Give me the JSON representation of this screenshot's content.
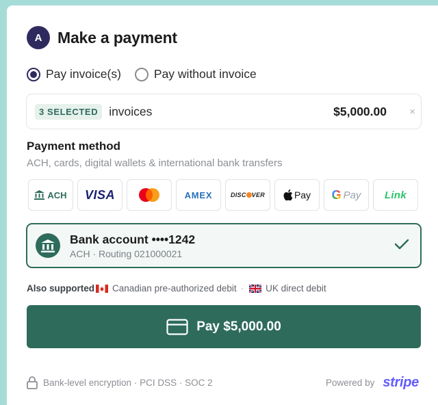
{
  "header": {
    "avatar_letter": "A",
    "title": "Make a payment"
  },
  "mode": {
    "options": [
      {
        "label": "Pay invoice(s)",
        "selected": true
      },
      {
        "label": "Pay without invoice",
        "selected": false
      }
    ]
  },
  "invoices": {
    "badge": "3 SELECTED",
    "label": "invoices",
    "amount": "$5,000.00",
    "clear_icon": "×"
  },
  "payment_method": {
    "title": "Payment method",
    "subtitle": "ACH, cards, digital wallets & international bank transfers",
    "methods": [
      {
        "name": "ach",
        "label": "ACH",
        "icon": "bank-icon"
      },
      {
        "name": "visa",
        "label": "VISA"
      },
      {
        "name": "mastercard",
        "label": ""
      },
      {
        "name": "amex",
        "label": "AMEX"
      },
      {
        "name": "discover",
        "label_a": "DISC",
        "label_b": "VER"
      },
      {
        "name": "apple-pay",
        "label": "Pay",
        "icon": "apple-icon"
      },
      {
        "name": "google-pay",
        "label_g": "G",
        "label": "Pay"
      },
      {
        "name": "link",
        "label": "Link"
      }
    ]
  },
  "bank": {
    "name": "Bank account ••••1242",
    "detail": "ACH · Routing 021000021",
    "icon": "bank-icon",
    "selected_icon": "check-icon"
  },
  "also_supported": {
    "label": "Also supported",
    "canada": "Canadian pre-authorized debit",
    "separator": "·",
    "uk": "UK direct debit"
  },
  "pay_button": {
    "label": "Pay $5,000.00",
    "icon": "card-icon"
  },
  "footer": {
    "security": "Bank-level encryption · PCI DSS · SOC 2",
    "powered_by": "Powered by",
    "brand": "stripe"
  },
  "colors": {
    "background": "#a6dcd8",
    "accent": "#2e6b5b",
    "avatar": "#2f2a5e",
    "stripe": "#635bff"
  }
}
